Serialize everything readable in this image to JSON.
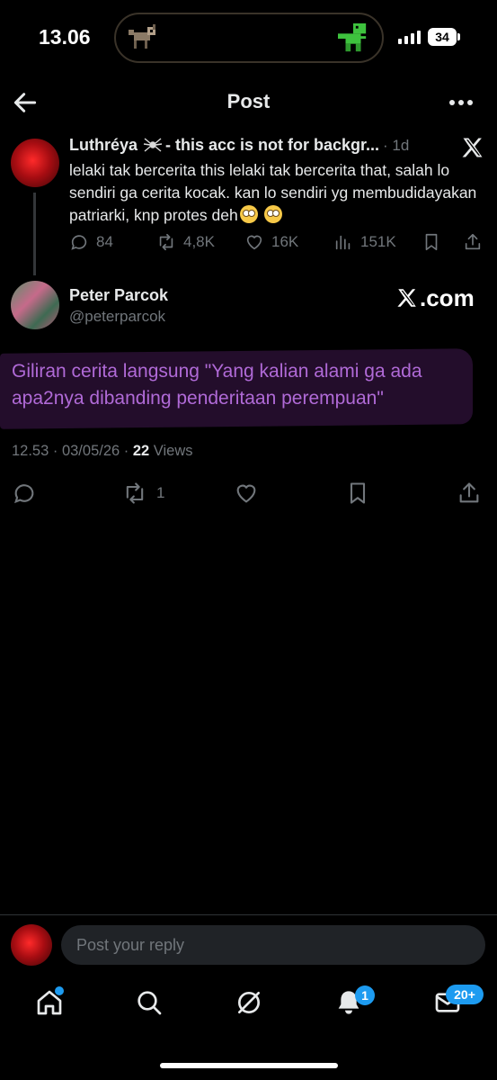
{
  "status_bar": {
    "time": "13.06",
    "battery": "34"
  },
  "header": {
    "title": "Post"
  },
  "parent_post": {
    "name": "Luthréya",
    "name_rest": " - this acc is not for backgr...",
    "time": "· 1d",
    "text": "lelaki tak bercerita this lelaki tak bercerita that, salah lo sendiri ga cerita kocak. kan lo sendiri yg membudidayakan patriarki, knp protes deh",
    "replies": "84",
    "reposts": "4,8K",
    "likes": "16K",
    "views": "151K"
  },
  "main_post": {
    "name": "Peter Parcok",
    "handle": "@peterparcok",
    "watermark": ".com",
    "text": "Giliran cerita langsung \"Yang kalian alami ga ada apa2nya dibanding penderitaan perempuan\"",
    "timestamp": "12.53 · 03/05/26 · ",
    "views_count": "22",
    "views_label": " Views",
    "reposts": "1"
  },
  "reply": {
    "placeholder": "Post your reply"
  },
  "nav": {
    "notifications_badge": "1",
    "messages_badge": "20+"
  },
  "colors": {
    "accent": "#1d9bf0",
    "highlight_text": "#b06ad7",
    "muted": "#71767b"
  }
}
